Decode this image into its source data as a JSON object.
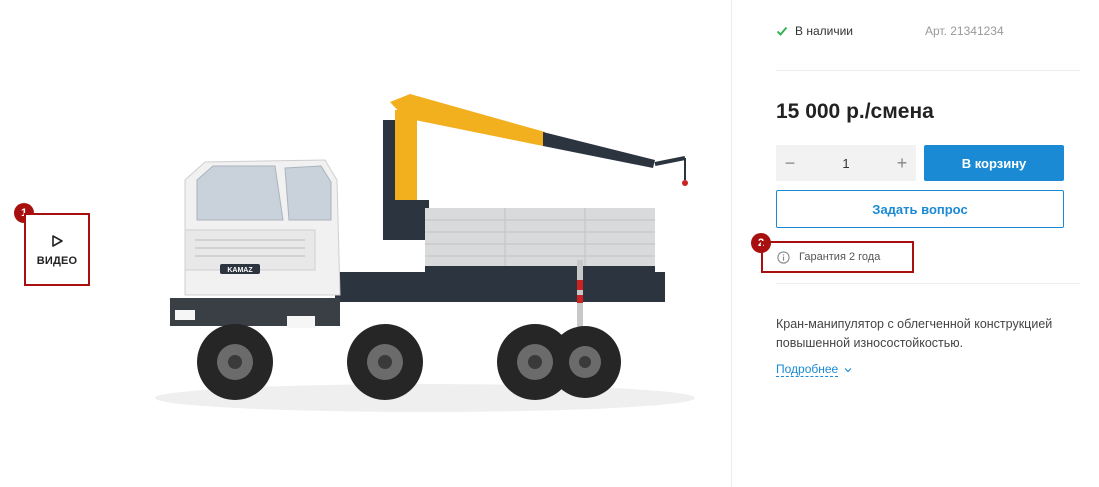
{
  "gallery": {
    "video_label": "ВИДЕО",
    "truck_brand": "KAMAZ"
  },
  "annotations": {
    "badge1": "1",
    "badge2": "2"
  },
  "product": {
    "stock_status": "В наличии",
    "article": "Арт. 21341234",
    "price": "15 000 р./смена",
    "quantity": "1",
    "qty_minus": "−",
    "qty_plus": "+",
    "cart_button": "В корзину",
    "ask_button": "Задать вопрос",
    "warranty": "Гарантия 2 года",
    "description": "Кран-манипулятор с облегченной конструкцией повышенной износостойкостью.",
    "more_link": "Подробнее"
  },
  "colors": {
    "accent": "#1a8ad4",
    "annotation": "#a80f0f",
    "in_stock": "#2bb04a",
    "crane_yellow": "#f2b01e"
  },
  "icons": {
    "video": "play-icon",
    "stock": "check-icon",
    "warranty": "info-icon",
    "more": "chevron-down-icon"
  }
}
